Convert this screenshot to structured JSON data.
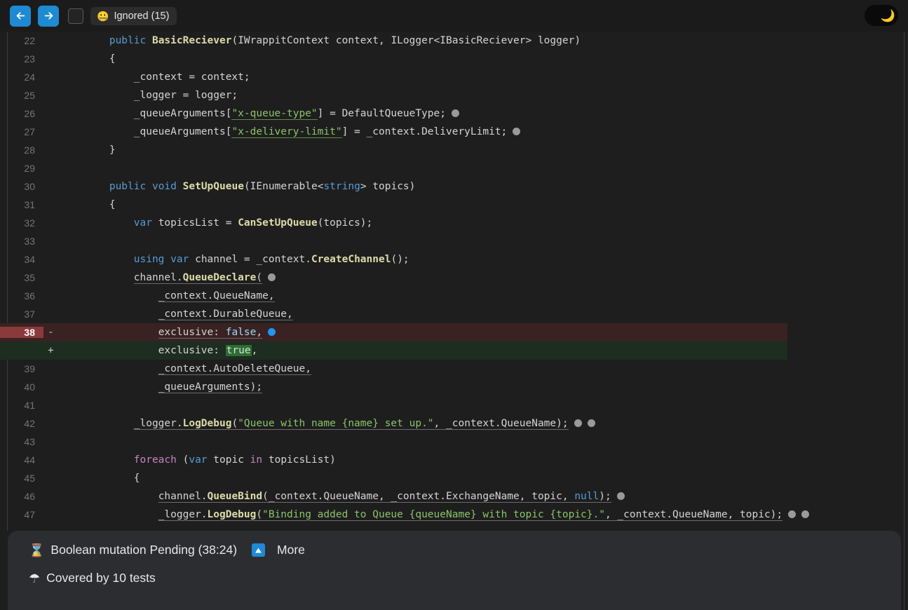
{
  "toolbar": {
    "back_icon": "arrow-left-icon",
    "forward_icon": "arrow-right-icon",
    "checkbox_checked": false,
    "filter_chip": {
      "emoji": "🤐",
      "label": "Ignored (15)"
    },
    "dark_mode_toggle": {
      "icon": "crescent-moon-icon",
      "glyph": "🌙",
      "enabled": true
    }
  },
  "colors": {
    "accent_blue": "#1f8ad4",
    "editor_bg": "#1e1e1e",
    "toolbar_bg": "#1b1b1b",
    "panel_bg": "#2c2d30",
    "diff_del_bg": "#3a2222",
    "diff_del_gutter": "#8a3a3a",
    "diff_add_bg": "#1d2d1f",
    "diff_add_gutter": "#2c6b33",
    "marker_dot": "#9a9a9a",
    "marker_dot_active": "#2196f3",
    "line_number": "#757575"
  },
  "editor": {
    "language": "csharp",
    "rows": [
      {
        "num": "22",
        "sign": "",
        "kind": "ctx",
        "html": "        <span class='kw'>public</span> <span class='cls'>BasicReciever</span>(IWrappitContext context, ILogger&lt;IBasicReciever&gt; logger)"
      },
      {
        "num": "23",
        "sign": "",
        "kind": "ctx",
        "html": "        {"
      },
      {
        "num": "24",
        "sign": "",
        "kind": "ctx",
        "html": "            _context = context;"
      },
      {
        "num": "25",
        "sign": "",
        "kind": "ctx",
        "html": "            _logger = logger;"
      },
      {
        "num": "26",
        "sign": "",
        "kind": "ctx",
        "html": "            _queueArguments[<span class='strg ug'>\"x-queue-type\"</span>] = DefaultQueueType;<span class='dot' data-name='mutation-marker-dot' data-interactable='true'></span>"
      },
      {
        "num": "27",
        "sign": "",
        "kind": "ctx",
        "html": "            _queueArguments[<span class='strg ug'>\"x-delivery-limit\"</span>] = _context.DeliveryLimit;<span class='dot' data-name='mutation-marker-dot' data-interactable='true'></span>"
      },
      {
        "num": "28",
        "sign": "",
        "kind": "ctx",
        "html": "        }"
      },
      {
        "num": "29",
        "sign": "",
        "kind": "ctx",
        "html": ""
      },
      {
        "num": "30",
        "sign": "",
        "kind": "ctx",
        "html": "        <span class='kw'>public</span> <span class='kw'>void</span> <span class='fn'>SetUpQueue</span>(IEnumerable&lt;<span class='kw'>string</span>&gt; topics)"
      },
      {
        "num": "31",
        "sign": "",
        "kind": "ctx",
        "html": "        {"
      },
      {
        "num": "32",
        "sign": "",
        "kind": "ctx",
        "html": "            <span class='kw'>var</span> topicsList = <span class='fn'>CanSetUpQueue</span>(topics);"
      },
      {
        "num": "33",
        "sign": "",
        "kind": "ctx",
        "html": ""
      },
      {
        "num": "34",
        "sign": "",
        "kind": "ctx",
        "html": "            <span class='kw'>using</span> <span class='kw'>var</span> channel = _context.<span class='fn'>CreateChannel</span>();"
      },
      {
        "num": "35",
        "sign": "",
        "kind": "ctx",
        "html": "            <span class='u'>channel.<span class='fn'>QueueDeclare</span>(</span><span class='dot' data-name='mutation-marker-dot' data-interactable='true'></span>"
      },
      {
        "num": "36",
        "sign": "",
        "kind": "ctx",
        "html": "                <span class='u'>_context.QueueName,</span>"
      },
      {
        "num": "37",
        "sign": "",
        "kind": "ctx",
        "html": "                <span class='u'>_context.DurableQueue,</span>"
      },
      {
        "num": "38",
        "sign": "-",
        "kind": "del",
        "html": "                <span class='u'>exclusive: <span class='blue'>false</span>,</span><span class='dot blue-dot' data-name='mutation-marker-dot-active' data-interactable='true'></span>"
      },
      {
        "num": "",
        "sign": "+",
        "kind": "add",
        "html": "                exclusive: <span class='hl-true'>true</span>,"
      },
      {
        "num": "39",
        "sign": "",
        "kind": "ctx",
        "html": "                <span class='u'>_context.AutoDeleteQueue,</span>"
      },
      {
        "num": "40",
        "sign": "",
        "kind": "ctx",
        "html": "                <span class='u'>_queueArguments);</span>"
      },
      {
        "num": "41",
        "sign": "",
        "kind": "ctx",
        "html": ""
      },
      {
        "num": "42",
        "sign": "",
        "kind": "ctx",
        "html": "            <span class='u'>_logger.<span class='fn'>LogDebug</span>(<span class='strg'>\"Queue with name {name} set up.\"</span>, _context.QueueName);</span><span class='dot' data-name='mutation-marker-dot' data-interactable='true'></span><span class='dot' data-name='mutation-marker-dot' data-interactable='true'></span>"
      },
      {
        "num": "43",
        "sign": "",
        "kind": "ctx",
        "html": ""
      },
      {
        "num": "44",
        "sign": "",
        "kind": "ctx",
        "html": "            <span class='kw2'>foreach</span> (<span class='kw'>var</span> topic <span class='kw2'>in</span> topicsList)"
      },
      {
        "num": "45",
        "sign": "",
        "kind": "ctx",
        "html": "            {"
      },
      {
        "num": "46",
        "sign": "",
        "kind": "ctx",
        "html": "                <span class='u'>channel.<span class='fn'>QueueBind</span>(_context.QueueName, _context.ExchangeName, topic, <span class='kw'>null</span>);</span><span class='dot' data-name='mutation-marker-dot' data-interactable='true'></span>"
      },
      {
        "num": "47",
        "sign": "",
        "kind": "ctx",
        "html": "                <span class='u'>_logger.<span class='fn'>LogDebug</span>(<span class='strg'>\"Binding added to Queue {queueName} with topic {topic}.\"</span>, _context.QueueName, topic);</span><span class='dot' data-name='mutation-marker-dot' data-interactable='true'></span><span class='dot' data-name='mutation-marker-dot' data-interactable='true'></span>"
      }
    ]
  },
  "bottom_panel": {
    "status": {
      "emoji": "⌛",
      "icon": "hourglass-icon",
      "text": "Boolean mutation Pending (38:24)",
      "more_icon": "triangle-up-icon",
      "more_label": "More"
    },
    "coverage": {
      "emoji": "☂",
      "icon": "umbrella-icon",
      "text": "Covered by 10 tests"
    }
  }
}
